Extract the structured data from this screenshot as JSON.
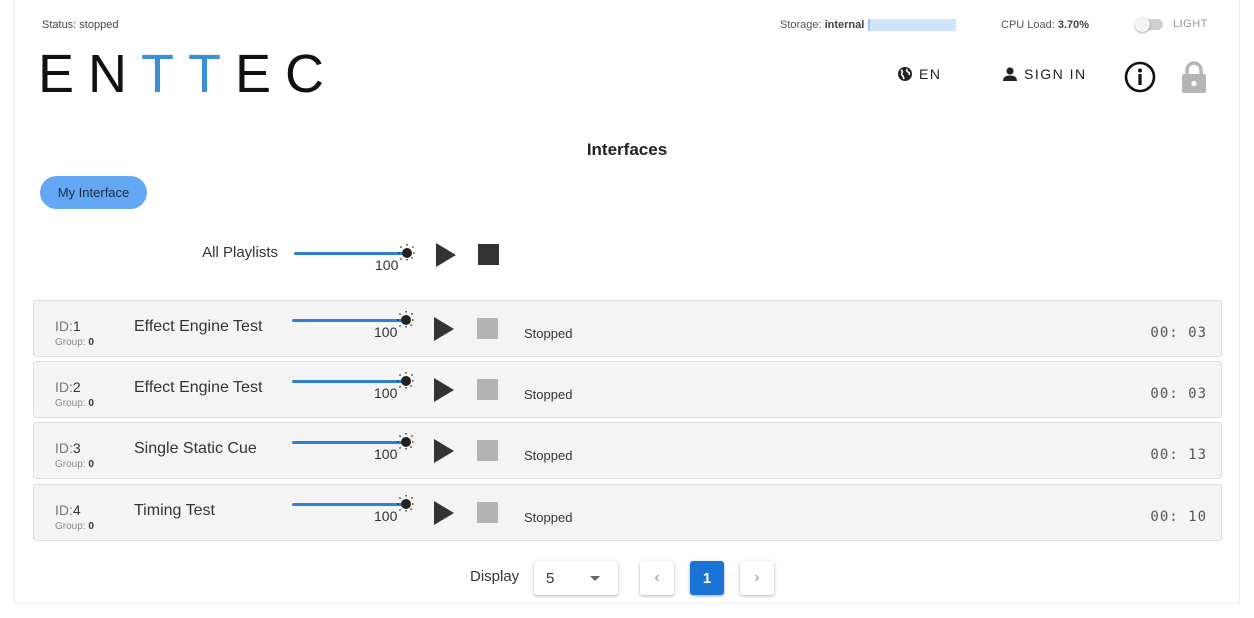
{
  "topbar": {
    "status": "Status: stopped",
    "storage_label": "Storage:",
    "storage_value": "internal",
    "cpu_label": "CPU Load:",
    "cpu_value": "3.70%",
    "theme_label": "LIGHT"
  },
  "logo": {
    "part1": "EN",
    "part2": "TT",
    "part3": "EC",
    "accent_color": "#3b8fd4"
  },
  "header": {
    "language": "EN",
    "signin": "SIGN IN"
  },
  "page_title": "Interfaces",
  "tab": {
    "label": "My Interface",
    "color": "#64a8f5"
  },
  "all_playlists": {
    "label": "All Playlists",
    "level": "100"
  },
  "playlists": [
    {
      "id_label": "ID:",
      "id": "1",
      "group_label": "Group:",
      "group": "0",
      "name": "Effect Engine Test",
      "level": "100",
      "state": "Stopped",
      "time": "00: 03"
    },
    {
      "id_label": "ID:",
      "id": "2",
      "group_label": "Group:",
      "group": "0",
      "name": "Effect Engine Test",
      "level": "100",
      "state": "Stopped",
      "time": "00: 03"
    },
    {
      "id_label": "ID:",
      "id": "3",
      "group_label": "Group:",
      "group": "0",
      "name": "Single Static Cue",
      "level": "100",
      "state": "Stopped",
      "time": "00: 13"
    },
    {
      "id_label": "ID:",
      "id": "4",
      "group_label": "Group:",
      "group": "0",
      "name": "Timing Test",
      "level": "100",
      "state": "Stopped",
      "time": "00: 10"
    }
  ],
  "pagination": {
    "display_label": "Display",
    "page_size": "5",
    "prev": "‹",
    "current_page": "1",
    "next": "›"
  },
  "colors": {
    "primary": "#1a73d6",
    "slider": "#2f7fd6"
  }
}
